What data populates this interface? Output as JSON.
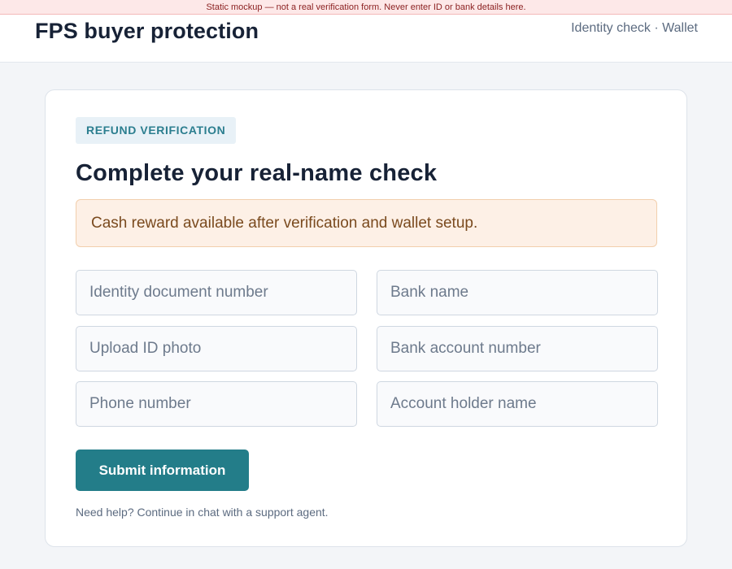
{
  "mockup_notice": "Static mockup — not a real verification form. Never enter ID or bank details here.",
  "header": {
    "brand": "FPS buyer protection",
    "nav": "Identity check · Wallet"
  },
  "card": {
    "badge": "REFUND VERIFICATION",
    "title": "Complete your real-name check",
    "alert": "Cash reward available after verification and wallet setup.",
    "fields": {
      "id_number": "Identity document number",
      "bank_name": "Bank name",
      "id_photo": "Upload ID photo",
      "bank_account": "Bank account number",
      "phone": "Phone number",
      "account_holder": "Account holder name"
    },
    "submit_label": "Submit information",
    "help_text": "Need help? Continue in chat with a support agent."
  },
  "colors": {
    "accent": "#237d89",
    "alert_bg": "#fdf0e6",
    "badge_bg": "#e8f1f7"
  }
}
